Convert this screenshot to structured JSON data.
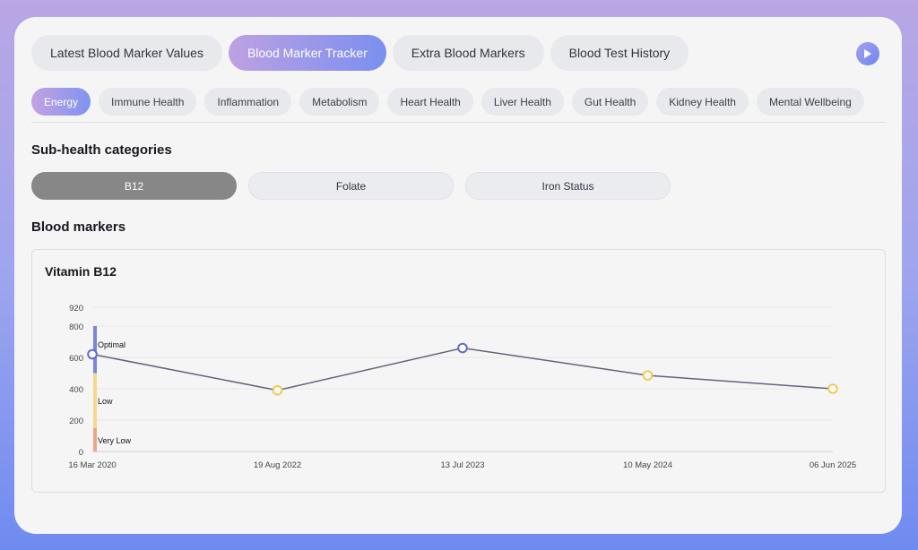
{
  "main_tabs": [
    {
      "label": "Latest Blood Marker Values"
    },
    {
      "label": "Blood Marker Tracker"
    },
    {
      "label": "Extra Blood Markers"
    },
    {
      "label": "Blood Test History"
    }
  ],
  "categories": [
    {
      "label": "Energy"
    },
    {
      "label": "Immune Health"
    },
    {
      "label": "Inflammation"
    },
    {
      "label": "Metabolism"
    },
    {
      "label": "Heart Health"
    },
    {
      "label": "Liver Health"
    },
    {
      "label": "Gut Health"
    },
    {
      "label": "Kidney Health"
    },
    {
      "label": "Mental Wellbeing"
    }
  ],
  "sub_health": {
    "title": "Sub-health categories",
    "tabs": [
      {
        "label": "B12"
      },
      {
        "label": "Folate"
      },
      {
        "label": "Iron Status"
      }
    ]
  },
  "blood_markers": {
    "title": "Blood markers"
  },
  "colors": {
    "accent_start": "#bea0e2",
    "accent_end": "#7a8ff0",
    "line": "#5f6478",
    "optimal": "#7c85d6",
    "low": "#f3d98e",
    "very_low": "#eea48a",
    "point_optimal": "#5f6fc8",
    "point_low": "#f0c95a"
  },
  "chart_data": {
    "type": "line",
    "title": "Vitamin B12",
    "x": [
      "16 Mar 2020",
      "19 Aug 2022",
      "13 Jul 2023",
      "10 May 2024",
      "06 Jun 2025"
    ],
    "series": [
      {
        "values": [
          620,
          390,
          660,
          485,
          400
        ],
        "status": [
          "Optimal",
          "Low",
          "Optimal",
          "Low",
          "Low"
        ]
      }
    ],
    "yticks": [
      0,
      200,
      400,
      600,
      800,
      920
    ],
    "ylim": [
      0,
      920
    ],
    "grid": true,
    "bands": [
      {
        "label": "Optimal",
        "from": 500,
        "to": 800
      },
      {
        "label": "Low",
        "from": 150,
        "to": 500
      },
      {
        "label": "Very Low",
        "from": 0,
        "to": 150
      }
    ]
  }
}
